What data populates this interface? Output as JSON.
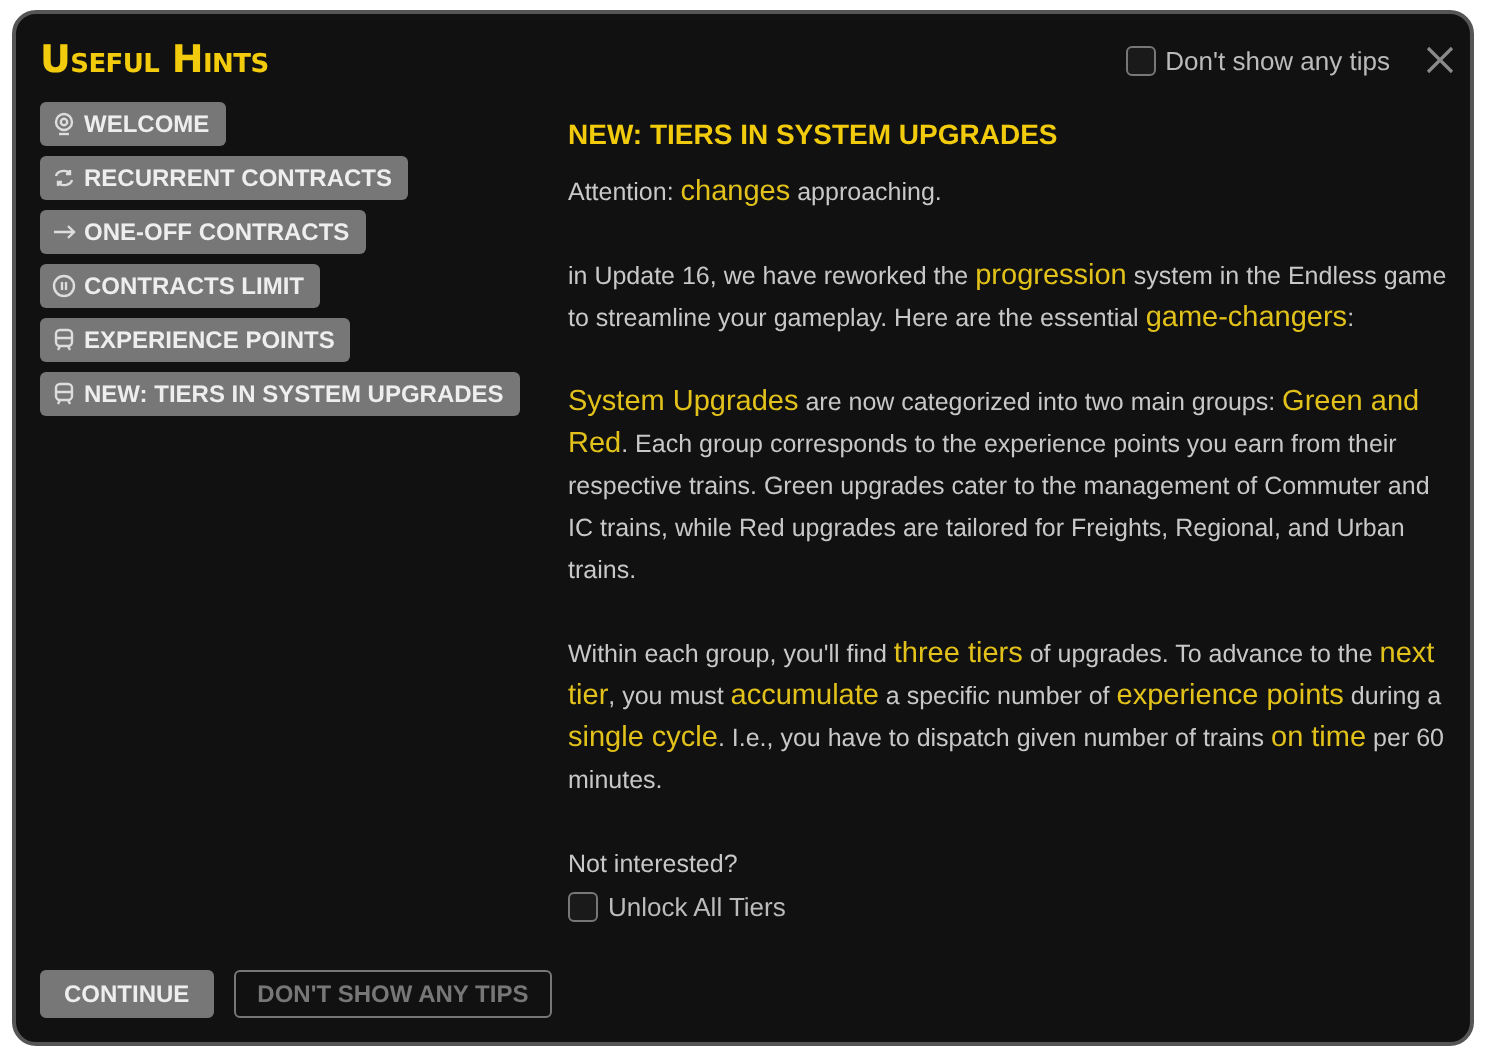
{
  "window": {
    "title": "Useful Hints"
  },
  "top_checkbox": {
    "label": "Don't show any tips",
    "checked": false
  },
  "sidebar": {
    "items": [
      {
        "label": "WELCOME",
        "kind": "pin"
      },
      {
        "label": "RECURRENT CONTRACTS",
        "kind": "cycle"
      },
      {
        "label": "ONE-OFF CONTRACTS",
        "kind": "arrow"
      },
      {
        "label": "CONTRACTS LIMIT",
        "kind": "pause"
      },
      {
        "label": "EXPERIENCE POINTS",
        "kind": "train"
      },
      {
        "label": "NEW: TIERS IN SYSTEM UPGRADES",
        "kind": "train"
      }
    ]
  },
  "content": {
    "heading": "NEW: TIERS IN SYSTEM UPGRADES",
    "paragraphs": [
      "Attention: **changes** approaching.",
      "in Update 16, we have reworked the **progression** system in the Endless game to streamline your gameplay. Here are the essential **game-changers**:",
      "**System Upgrades** are now categorized into two main groups: **Green and Red**. Each group corresponds to the experience points you earn from their respective trains. Green upgrades cater to the management of Commuter and IC trains, while Red upgrades are tailored for Freights, Regional, and Urban trains.",
      "Within each group, you'll find **three tiers** of upgrades. To advance to the **next tier**, you must **accumulate** a specific number of **experience points** during a **single cycle**. I.e., you have to dispatch given number of trains **on time** per 60 minutes."
    ],
    "question": "Not interested?",
    "unlock_checkbox": {
      "label": "Unlock All Tiers",
      "checked": false
    }
  },
  "buttons": [
    {
      "label": "CONTINUE",
      "kind": "filled"
    },
    {
      "label": "DON'T SHOW ANY TIPS",
      "kind": "outline"
    }
  ]
}
